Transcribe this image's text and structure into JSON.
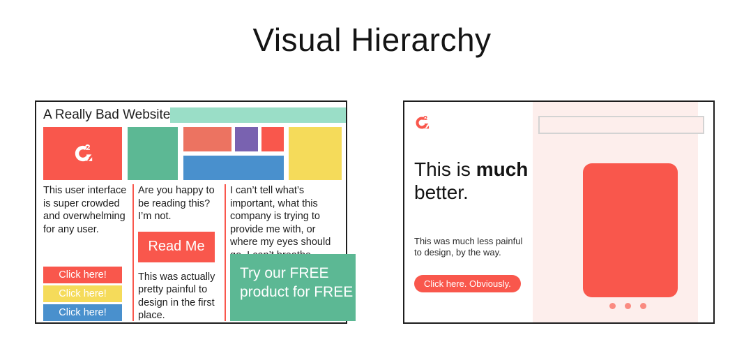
{
  "page": {
    "title": "Visual Hierarchy",
    "background_color": "#ffffff"
  },
  "palette": {
    "red": "#f9574c",
    "salmon": "#ec7361",
    "purple": "#7962b0",
    "blue": "#4990cd",
    "yellow": "#f5db5a",
    "green": "#5cb894",
    "mint": "#9adec7",
    "pink_tint": "#fdeeec",
    "dot_pink": "#fa8b81",
    "border": "#1d1d1d",
    "text": "#1d1d1d"
  },
  "bad_panel": {
    "name": "bad-website-mockup",
    "site_title": "A Really Bad Website",
    "header_bar_color": "#9adec7",
    "blocks": [
      {
        "name": "logo-block",
        "color": "#f9574c",
        "icon": "g2-logo-icon"
      },
      {
        "name": "green-block",
        "color": "#5cb894"
      },
      {
        "name": "salmon-block",
        "color": "#ec7361"
      },
      {
        "name": "purple-block",
        "color": "#7962b0"
      },
      {
        "name": "red-block",
        "color": "#f9574c"
      },
      {
        "name": "blue-block",
        "color": "#4990cd"
      },
      {
        "name": "yellow-block",
        "color": "#f5db5a"
      }
    ],
    "column_1": {
      "paragraph": "This user interface is super crowded and overwhelming for any user.",
      "buttons": [
        {
          "label": "Click here!",
          "color": "#f9574c"
        },
        {
          "label": "Click here!",
          "color": "#f5db5a"
        },
        {
          "label": "Click here!",
          "color": "#4990cd"
        }
      ]
    },
    "column_2": {
      "paragraph": "Are you happy to be reading this? I’m not.",
      "button_label": "Read Me",
      "paragraph_2": "This was actually pretty painful to design in the first place."
    },
    "column_3": {
      "paragraph": "I can’t tell what’s important, what this company is trying to provide me with, or where my eyes should go. I can’t breathe.",
      "cta_label": "Try our FREE product for FREE",
      "cta_color": "#5cb894"
    }
  },
  "good_panel": {
    "name": "good-website-mockup",
    "logo_icon": "g2-logo-icon",
    "search_placeholder": "",
    "search_value": "",
    "heading_part_1": "This is ",
    "heading_bold": "much",
    "heading_part_2": "better.",
    "subtext": "This was much less painful to design, by the way.",
    "button_label": "Click here. Obviously.",
    "button_color": "#f9574c",
    "hero_color": "#f9574c",
    "band_color": "#fdeeec",
    "carousel_dots": 3
  }
}
